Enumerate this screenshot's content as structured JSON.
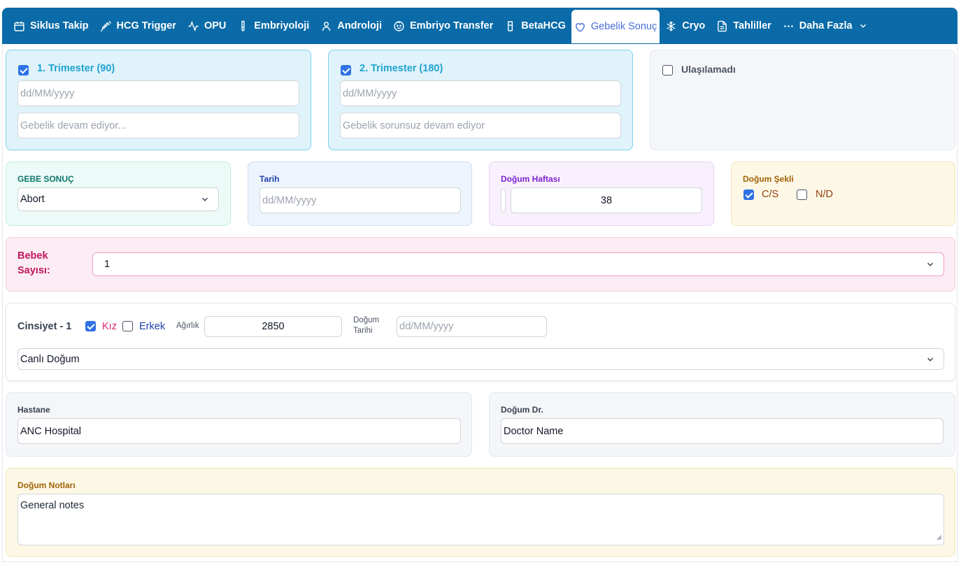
{
  "nav": {
    "items": [
      {
        "label": "Siklus Takip",
        "icon": "calendar-icon"
      },
      {
        "label": "HCG Trigger",
        "icon": "syringe-icon"
      },
      {
        "label": "OPU",
        "icon": "activity-icon"
      },
      {
        "label": "Embriyoloji",
        "icon": "test-tube-icon"
      },
      {
        "label": "Androloji",
        "icon": "user-icon"
      },
      {
        "label": "Embriyo Transfer",
        "icon": "baby-icon"
      },
      {
        "label": "BetaHCG",
        "icon": "beaker-icon"
      },
      {
        "label": "Gebelik Sonuç",
        "icon": "heart-icon"
      },
      {
        "label": "Cryo",
        "icon": "snowflake-icon"
      },
      {
        "label": "Tahliller",
        "icon": "document-icon"
      },
      {
        "label": "Daha Fazla",
        "icon": "more-icon"
      }
    ],
    "active_index": 7,
    "bg_color": "#0a6ba8"
  },
  "trimester1": {
    "label": "1. Trimester (90)",
    "checked": true,
    "date_placeholder": "dd/MM/yyyy",
    "note_placeholder": "Gebelik devam ediyor..."
  },
  "trimester2": {
    "label": "2. Trimester (180)",
    "checked": true,
    "date_placeholder": "dd/MM/yyyy",
    "note_placeholder": "Gebelik sorunsuz devam ediyor"
  },
  "unreachable": {
    "label": "Ulaşılamadı",
    "checked": false
  },
  "result": {
    "label": "GEBE SONUÇ",
    "value": "Abort"
  },
  "date": {
    "label": "Tarih",
    "placeholder": "dd/MM/yyyy"
  },
  "birth_week": {
    "label": "Doğum Haftası",
    "value": "38"
  },
  "birth_type": {
    "label": "Doğum Şekli",
    "options": [
      {
        "label": "C/S",
        "checked": true
      },
      {
        "label": "N/D",
        "checked": false
      }
    ]
  },
  "baby_count": {
    "label_line1": "Bebek",
    "label_line2": "Sayısı:",
    "value": "1"
  },
  "baby1": {
    "gender_label": "Cinsiyet - 1",
    "girl_label": "Kız",
    "girl_checked": true,
    "boy_label": "Erkek",
    "boy_checked": false,
    "weight_label": "Ağırlık",
    "weight_value": "2850",
    "birth_date_label_line1": "Doğum",
    "birth_date_label_line2": "Tarihi",
    "birth_date_placeholder": "dd/MM/yyyy",
    "outcome_value": "Canlı Doğum"
  },
  "hospital": {
    "label": "Hastane",
    "value": "ANC Hospital"
  },
  "doctor": {
    "label": "Doğum Dr.",
    "value": "Doctor Name"
  },
  "notes": {
    "label": "Doğum Notları",
    "value": "General notes"
  }
}
